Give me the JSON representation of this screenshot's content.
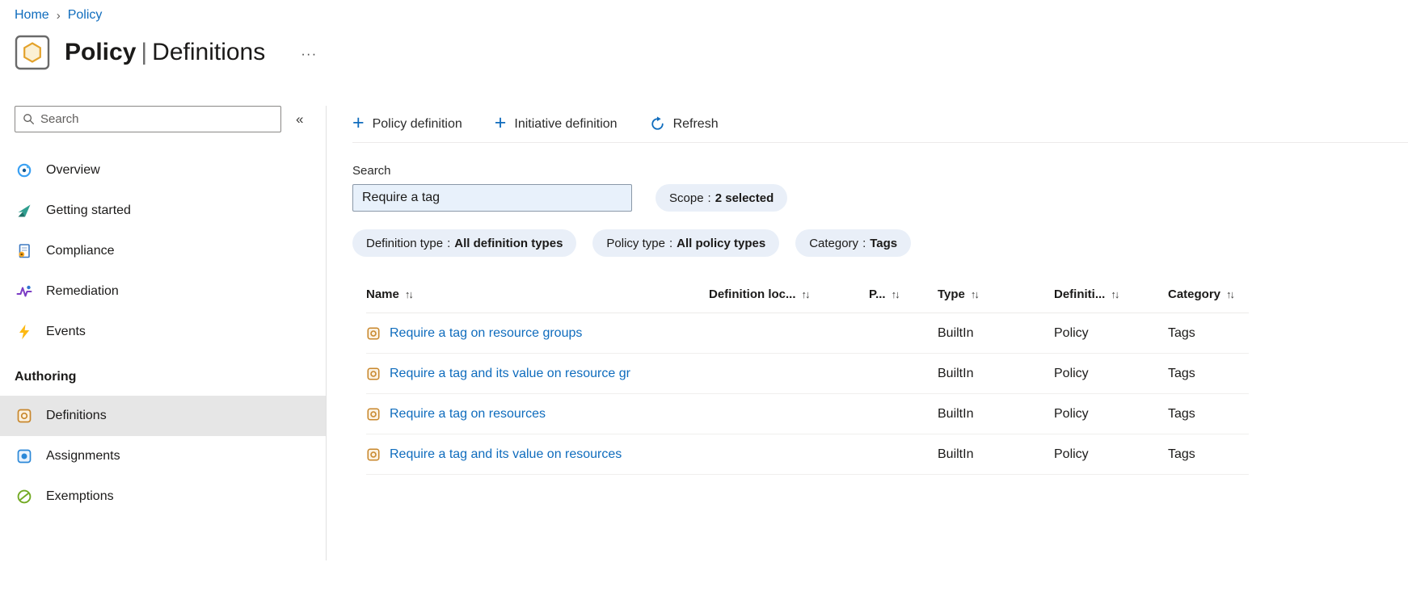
{
  "breadcrumb": {
    "items": [
      {
        "label": "Home"
      },
      {
        "label": "Policy"
      }
    ]
  },
  "header": {
    "title_primary": "Policy",
    "title_separator": "|",
    "title_secondary": "Definitions"
  },
  "icons": {
    "sort": "↑↓",
    "collapse": "«",
    "more": "···",
    "breadcrumb_separator": "›",
    "plus": "+"
  },
  "sidebar": {
    "search_placeholder": "Search",
    "items": [
      {
        "label": "Overview"
      },
      {
        "label": "Getting started"
      },
      {
        "label": "Compliance"
      },
      {
        "label": "Remediation"
      },
      {
        "label": "Events"
      }
    ],
    "section": {
      "label": "Authoring",
      "items": [
        {
          "label": "Definitions",
          "selected": true
        },
        {
          "label": "Assignments",
          "selected": false
        },
        {
          "label": "Exemptions",
          "selected": false
        }
      ]
    }
  },
  "toolbar": {
    "actions": [
      {
        "label": "Policy definition"
      },
      {
        "label": "Initiative definition"
      },
      {
        "label": "Refresh"
      }
    ]
  },
  "filters": {
    "search_label": "Search",
    "search_value": "Require a tag",
    "separator": ":",
    "pills": [
      {
        "label": "Scope",
        "value": "2 selected"
      },
      {
        "label": "Definition type",
        "value": "All definition types"
      },
      {
        "label": "Policy type",
        "value": "All policy types"
      },
      {
        "label": "Category",
        "value": "Tags"
      }
    ]
  },
  "table": {
    "columns": [
      {
        "label": "Name"
      },
      {
        "label": "Definition loc..."
      },
      {
        "label": "P..."
      },
      {
        "label": "Type"
      },
      {
        "label": "Definiti..."
      },
      {
        "label": "Category"
      }
    ],
    "rows": [
      {
        "name": "Require a tag on resource groups",
        "type": "BuiltIn",
        "definition_type": "Policy",
        "category": "Tags"
      },
      {
        "name": "Require a tag and its value on resource gr",
        "type": "BuiltIn",
        "definition_type": "Policy",
        "category": "Tags"
      },
      {
        "name": "Require a tag on resources",
        "type": "BuiltIn",
        "definition_type": "Policy",
        "category": "Tags"
      },
      {
        "name": "Require a tag and its value on resources",
        "type": "BuiltIn",
        "definition_type": "Policy",
        "category": "Tags"
      }
    ]
  },
  "colors": {
    "link_blue": "#0f6cbd",
    "pill_background": "#e9eff8",
    "selected_item_background": "#e6e6e6",
    "search_input_background": "#e8f1fb",
    "policy_icon_orange": "#c8872c",
    "events_yellow": "#fdb913",
    "exemptions_green": "#73aa24"
  }
}
